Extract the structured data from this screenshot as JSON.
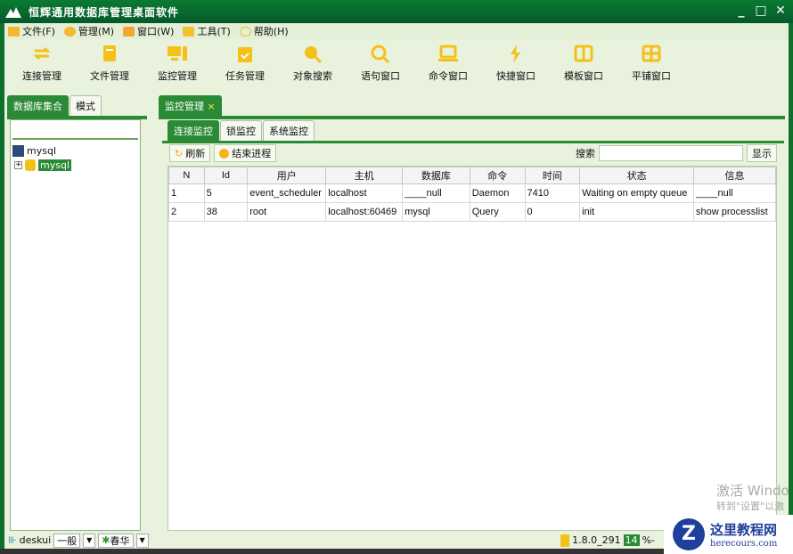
{
  "window": {
    "title": "恒辉通用数据库管理桌面软件"
  },
  "menu": [
    {
      "label": "文件(F)",
      "color": "#f2b82e"
    },
    {
      "label": "管理(M)",
      "color": "#f2b82e"
    },
    {
      "label": "窗口(W)",
      "color": "#f2a72e"
    },
    {
      "label": "工具(T)",
      "color": "#f2c22e"
    },
    {
      "label": "帮助(H)",
      "color": "#f2c22e"
    }
  ],
  "toolbar": [
    {
      "label": "连接管理",
      "icon": "sync-icon"
    },
    {
      "label": "文件管理",
      "icon": "book-icon"
    },
    {
      "label": "监控管理",
      "icon": "monitor-icon"
    },
    {
      "label": "任务管理",
      "icon": "calendar-check-icon"
    },
    {
      "label": "对象搜索",
      "icon": "search-chart-icon"
    },
    {
      "label": "语句窗口",
      "icon": "search-icon"
    },
    {
      "label": "命令窗口",
      "icon": "laptop-code-icon"
    },
    {
      "label": "快捷窗口",
      "icon": "lightning-icon"
    },
    {
      "label": "模板窗口",
      "icon": "columns-icon"
    },
    {
      "label": "平铺窗口",
      "icon": "grid-icon"
    }
  ],
  "left": {
    "tabs": [
      "数据库集合",
      "模式"
    ],
    "tree": {
      "root": "mysql",
      "child": "mysql"
    }
  },
  "main": {
    "tab": "监控管理",
    "close": "×",
    "subtabs": [
      "连接监控",
      "锁监控",
      "系统监控"
    ],
    "refresh": "刷新",
    "kill": "结束进程",
    "search_label": "搜索",
    "search_value": "",
    "show": "显示"
  },
  "table": {
    "headers": [
      "N",
      "Id",
      "用户",
      "主机",
      "数据库",
      "命令",
      "时间",
      "状态",
      "信息"
    ],
    "rows": [
      [
        "1",
        "5",
        "event_scheduler",
        "localhost",
        "____null",
        "Daemon",
        "7410",
        "Waiting on empty queue",
        "____null"
      ],
      [
        "2",
        "38",
        "root",
        "localhost:60469",
        "mysql",
        "Query",
        "0",
        "init",
        "show processlist"
      ]
    ]
  },
  "status": {
    "user": "deskui",
    "level": "一般",
    "theme": "春华",
    "version": "1.8.0_291",
    "mem": "14",
    "mem_suffix": "%-"
  },
  "watermark": {
    "line1": "激活 Windo",
    "line2": "转到\"设置\"以激",
    "logo_cn": "这里教程网",
    "logo_en": "herecours.com"
  },
  "colors": {
    "accent": "#2b8a36",
    "icon": "#f5c118"
  }
}
